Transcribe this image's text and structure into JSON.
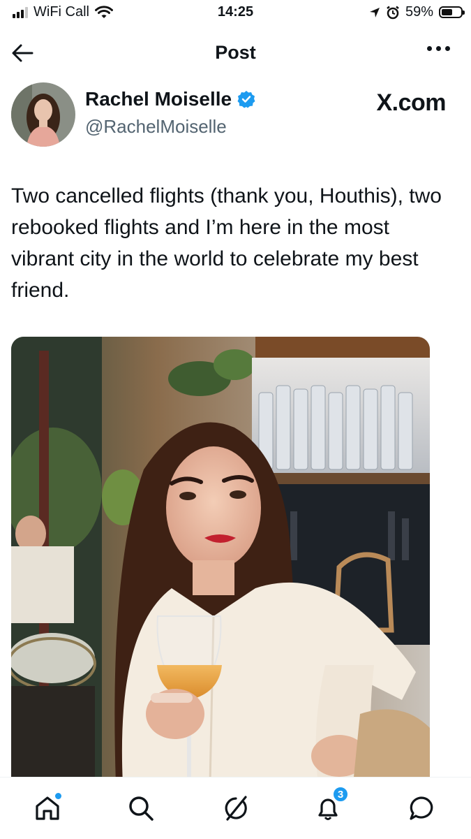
{
  "status_bar": {
    "carrier": "WiFi Call",
    "time": "14:25",
    "battery": "59%",
    "battery_level": 0.59,
    "icons": [
      "signal-icon",
      "wifi-icon",
      "location-arrow-icon",
      "alarm-icon",
      "battery-icon"
    ]
  },
  "header": {
    "title": "Post",
    "back_icon": "arrow-left-icon",
    "more_icon": "more-horizontal-icon"
  },
  "post": {
    "author_name": "Rachel Moiselle",
    "author_handle": "@RachelMoiselle",
    "verified": true,
    "watermark": "X.com",
    "text": "Two cancelled flights (thank you, Houthis), two rebooked flights and I’m here in the most vibrant city in the world to celebrate my best friend."
  },
  "tabbar": {
    "items": [
      {
        "name": "home",
        "icon": "home-icon",
        "active": true
      },
      {
        "name": "search",
        "icon": "search-icon"
      },
      {
        "name": "grok",
        "icon": "grok-icon"
      },
      {
        "name": "notifications",
        "icon": "bell-icon",
        "badge": "3"
      },
      {
        "name": "messages",
        "icon": "chat-bubble-icon"
      }
    ]
  },
  "colors": {
    "accent": "#1d9bf0",
    "text": "#0f1419",
    "secondary": "#536471"
  }
}
